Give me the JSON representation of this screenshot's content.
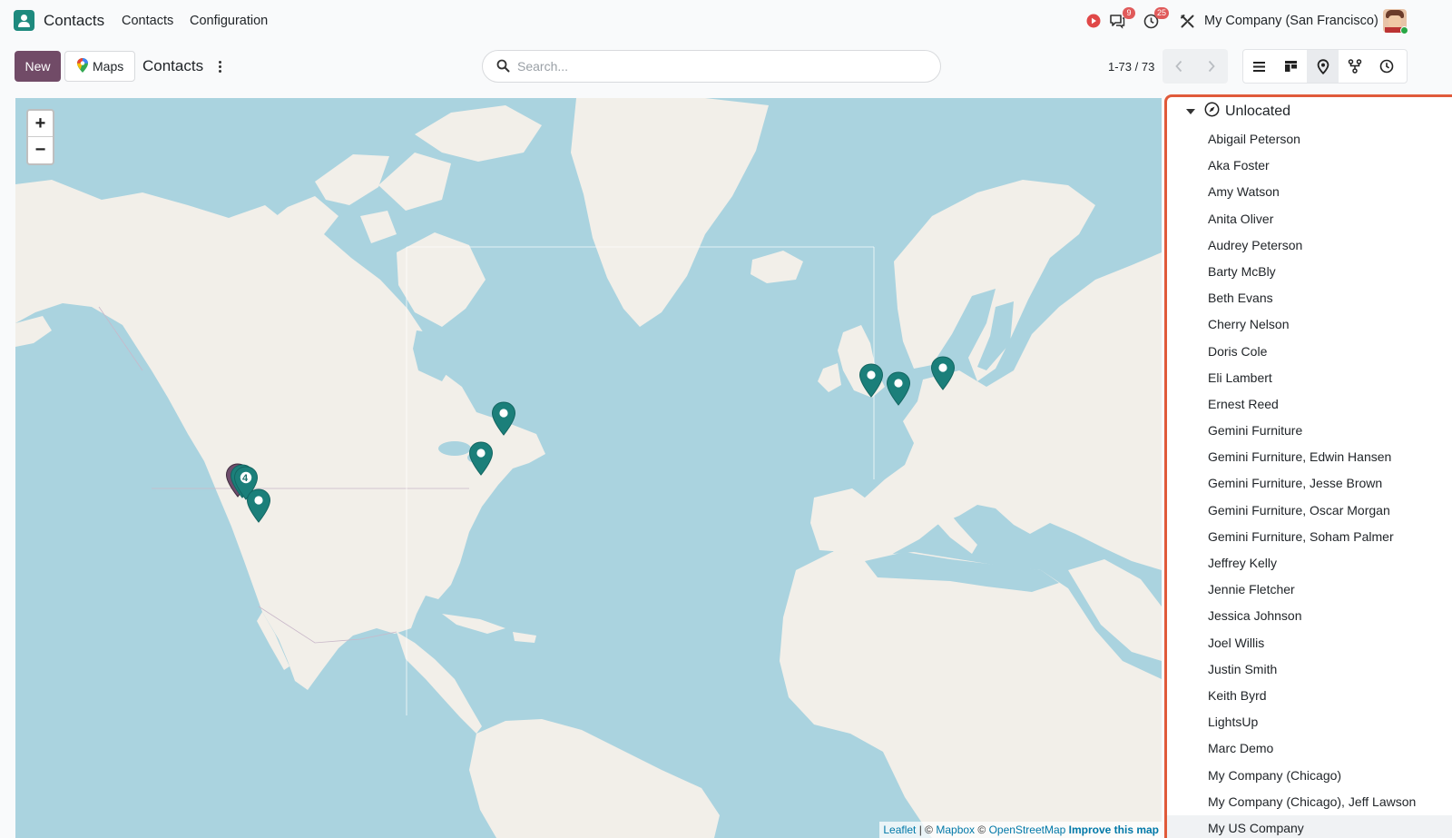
{
  "navbar": {
    "app_name": "Contacts",
    "menus": [
      "Contacts",
      "Configuration"
    ],
    "messages_badge": "9",
    "activities_badge": "25",
    "company": "My Company (San Francisco)"
  },
  "control_panel": {
    "new_label": "New",
    "maps_label": "Maps",
    "breadcrumb": "Contacts",
    "search_placeholder": "Search...",
    "pager": "1-73 / 73",
    "views": [
      "list-view-icon",
      "kanban-view-icon",
      "map-view-icon",
      "hierarchy-view-icon",
      "activity-view-icon"
    ],
    "active_view": "map-view-icon"
  },
  "map": {
    "zoom_in": "+",
    "zoom_out": "−",
    "cluster_count": "4",
    "marker_color": "#1b7f7a",
    "attribution": {
      "leaflet": "Leaflet",
      "sep": " | © ",
      "mapbox": "Mapbox",
      "copy": " © ",
      "osm": "OpenStreetMap",
      "improve": "Improve this map"
    }
  },
  "panel": {
    "group_label": "Unlocated",
    "contacts": [
      "Abigail Peterson",
      "Aka Foster",
      "Amy Watson",
      "Anita Oliver",
      "Audrey Peterson",
      "Barty McBly",
      "Beth Evans",
      "Cherry Nelson",
      "Doris Cole",
      "Eli Lambert",
      "Ernest Reed",
      "Gemini Furniture",
      "Gemini Furniture, Edwin Hansen",
      "Gemini Furniture, Jesse Brown",
      "Gemini Furniture, Oscar Morgan",
      "Gemini Furniture, Soham Palmer",
      "Jeffrey Kelly",
      "Jennie Fletcher",
      "Jessica Johnson",
      "Joel Willis",
      "Justin Smith",
      "Keith Byrd",
      "LightsUp",
      "Marc Demo",
      "My Company (Chicago)",
      "My Company (Chicago), Jeff Lawson",
      "My US Company"
    ]
  },
  "colors": {
    "primary": "#714b67",
    "accent": "#1b7f7a",
    "panel_border": "#e05a3a",
    "water": "#aad3df",
    "land": "#f2efe9"
  }
}
